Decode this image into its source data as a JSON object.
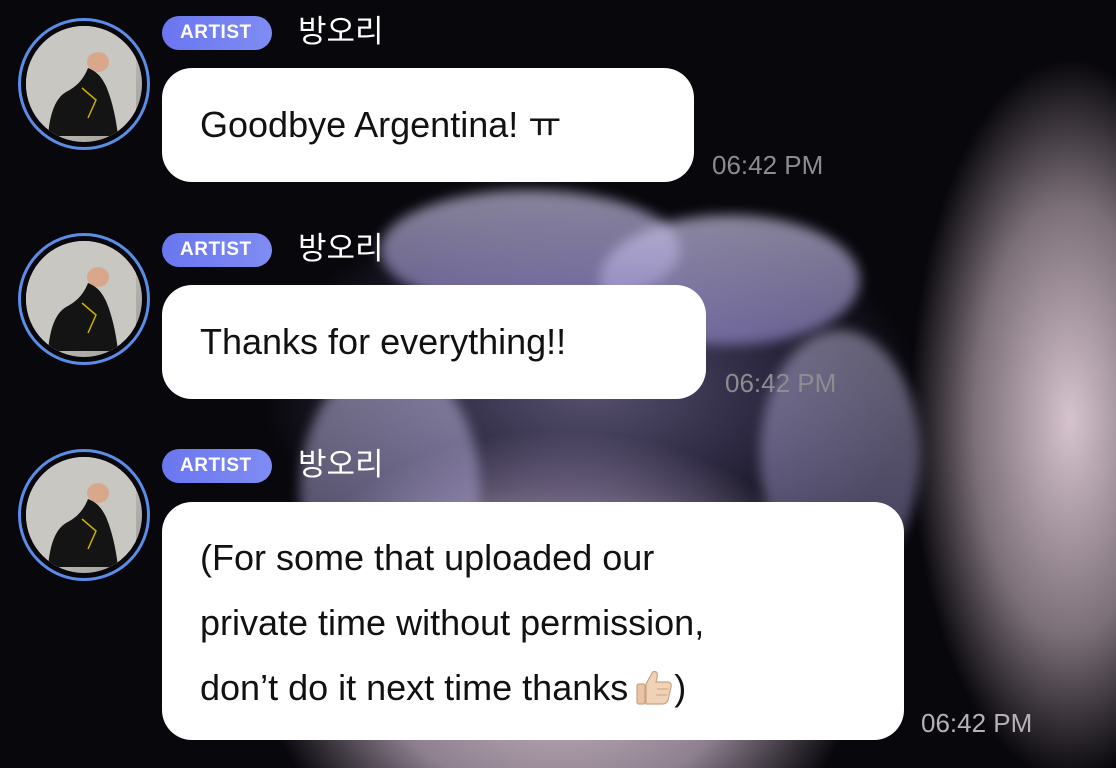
{
  "messages": [
    {
      "role_badge": "ARTIST",
      "username": "방오리",
      "text": "Goodbye Argentina! ㅠ",
      "time": "06:42 PM",
      "avatar_icon": "artist-avatar-photo"
    },
    {
      "role_badge": "ARTIST",
      "username": "방오리",
      "text": "Thanks for everything!!",
      "time": "06:42 PM",
      "avatar_icon": "artist-avatar-photo"
    },
    {
      "role_badge": "ARTIST",
      "username": "방오리",
      "text_lines": [
        "(For some that uploaded our",
        "private time without permission,",
        "don’t do it next time thanks"
      ],
      "text_suffix": ")",
      "emoji_icon": "thumbs-up-icon",
      "time": "06:42 PM",
      "avatar_icon": "artist-avatar-photo"
    }
  ],
  "colors": {
    "badge_gradient_start": "#6a76f0",
    "badge_gradient_end": "#7f8cf2",
    "avatar_ring": "#5b8de6",
    "bubble": "#ffffff",
    "timestamp": "#8b8b92",
    "background": "#08070c"
  }
}
